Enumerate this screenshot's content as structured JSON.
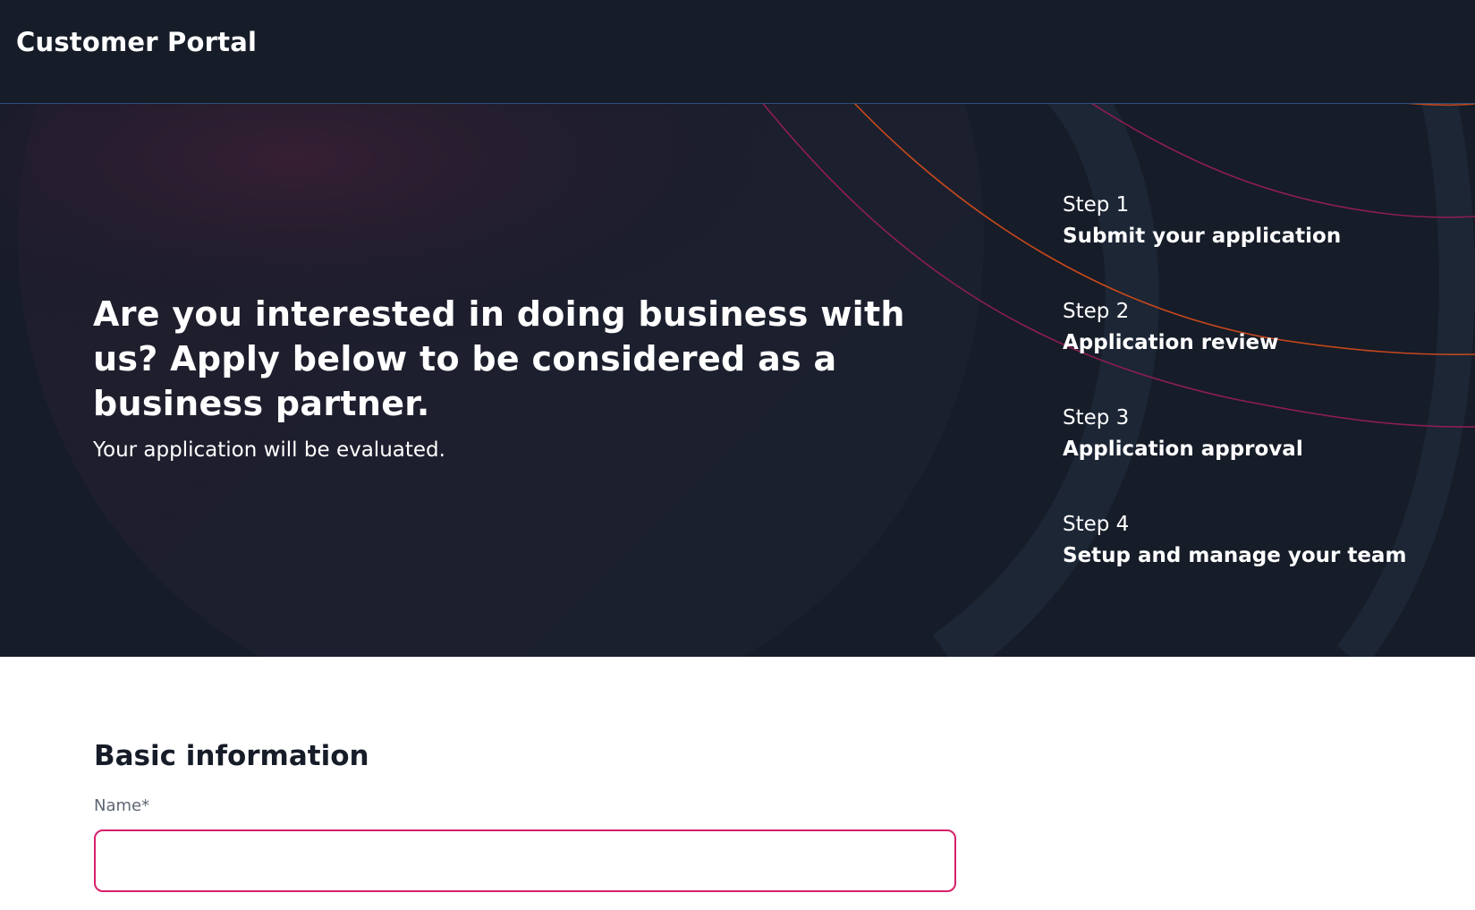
{
  "app": {
    "title": "Customer Portal"
  },
  "hero": {
    "heading": "Are you interested in doing business with us? Apply below to be considered as a business partner.",
    "subheading": "Your application will be evaluated.",
    "steps": [
      {
        "label": "Step 1",
        "title": "Submit your application"
      },
      {
        "label": "Step 2",
        "title": "Application review"
      },
      {
        "label": "Step 3",
        "title": "Application approval"
      },
      {
        "label": "Step 4",
        "title": "Setup and manage your team"
      }
    ]
  },
  "form": {
    "section_title": "Basic information",
    "name_label": "Name*",
    "name_value": "",
    "name_placeholder": ""
  },
  "colors": {
    "background_dark": "#161c28",
    "accent_magenta": "#d6206b",
    "accent_orange": "#e0541b",
    "divider_blue": "#2b4f78"
  }
}
